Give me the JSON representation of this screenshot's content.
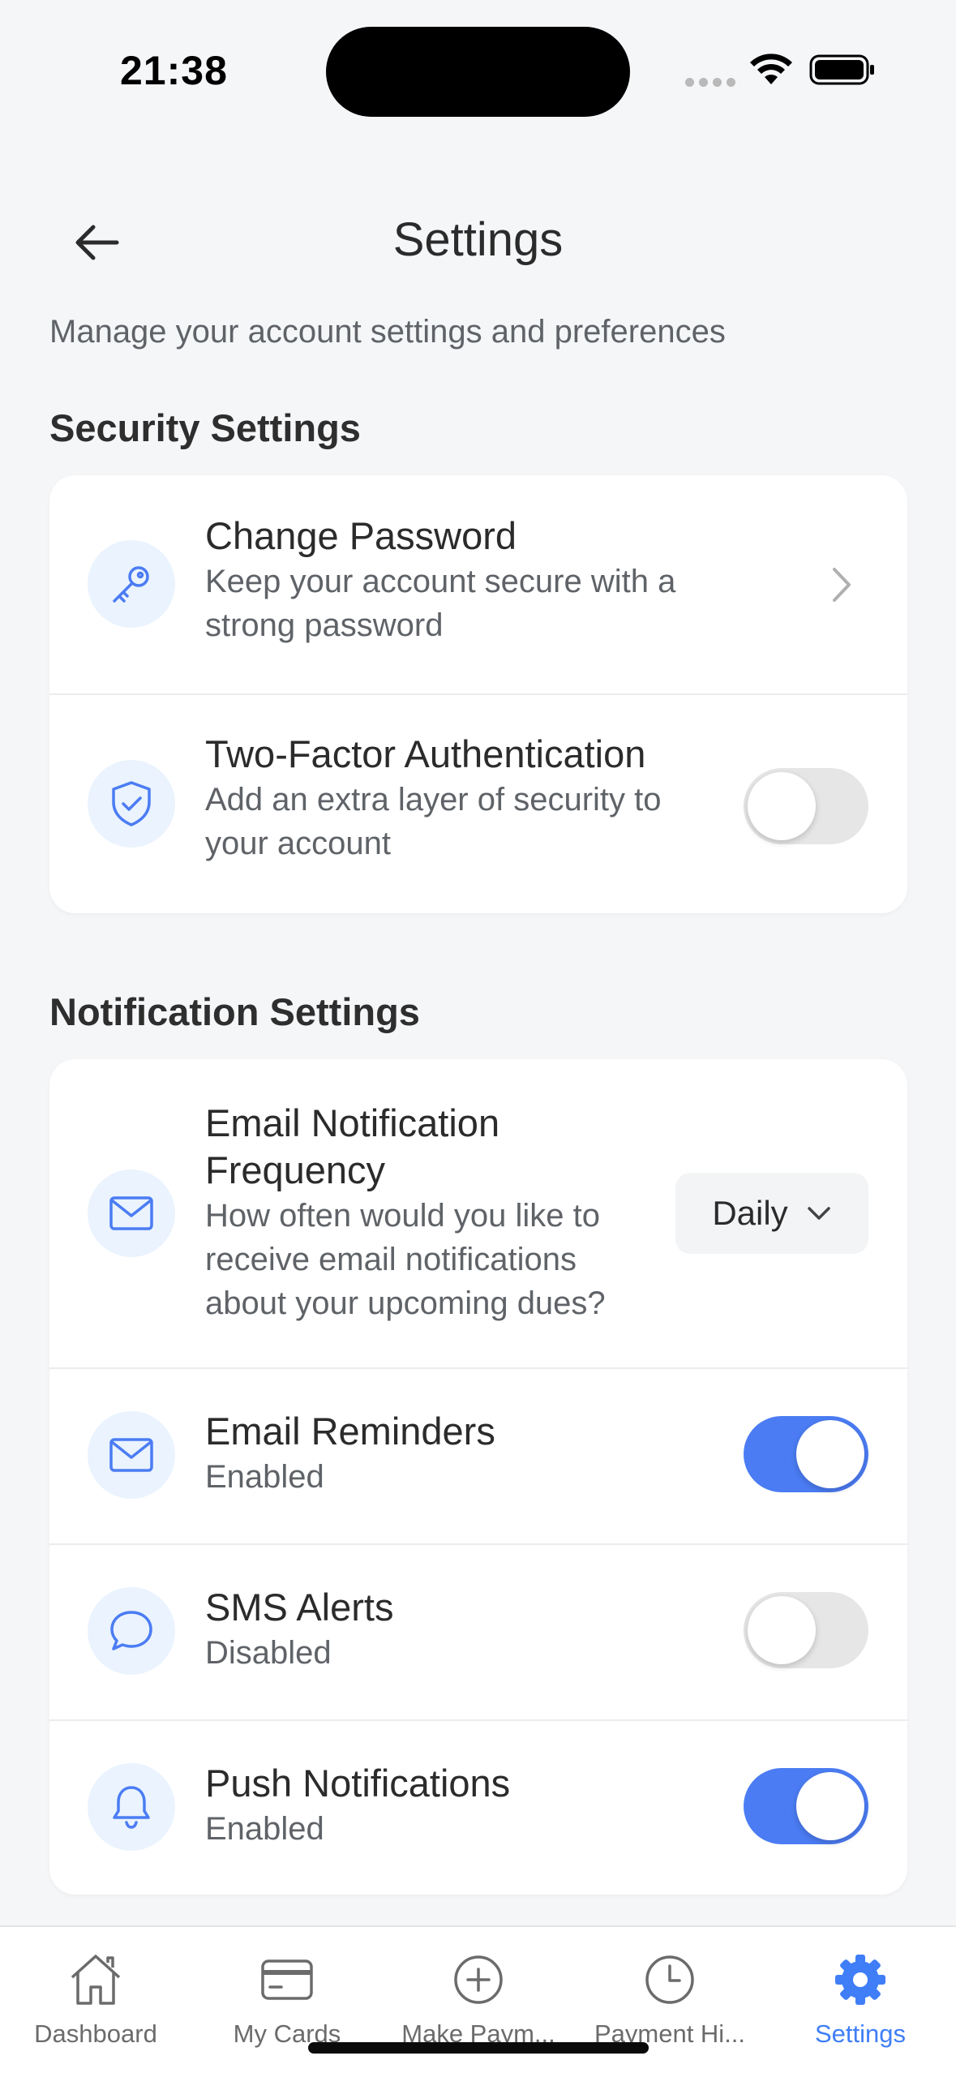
{
  "status_bar": {
    "time": "21:38"
  },
  "header": {
    "title": "Settings",
    "subtitle": "Manage your account settings and preferences"
  },
  "security": {
    "section_title": "Security Settings",
    "items": [
      {
        "title": "Change Password",
        "description": "Keep your account secure with a strong password",
        "control": "chevron",
        "icon": "key-icon"
      },
      {
        "title": "Two-Factor Authentication",
        "description": "Add an extra layer of security to your account",
        "control": "toggle",
        "enabled": false,
        "icon": "shield-check-icon"
      }
    ]
  },
  "notifications": {
    "section_title": "Notification Settings",
    "items": [
      {
        "title": "Email Notification Frequency",
        "description": "How often would you like to receive email notifications about your upcoming dues?",
        "control": "select",
        "selected": "Daily",
        "icon": "mail-icon"
      },
      {
        "title": "Email Reminders",
        "description": "Enabled",
        "control": "toggle",
        "enabled": true,
        "icon": "mail-icon"
      },
      {
        "title": "SMS Alerts",
        "description": "Disabled",
        "control": "toggle",
        "enabled": false,
        "icon": "chat-bubble-icon"
      },
      {
        "title": "Push Notifications",
        "description": "Enabled",
        "control": "toggle",
        "enabled": true,
        "icon": "bell-icon"
      }
    ]
  },
  "tab_bar": {
    "tabs": [
      {
        "label": "Dashboard",
        "icon": "home-icon",
        "active": false
      },
      {
        "label": "My Cards",
        "icon": "card-icon",
        "active": false
      },
      {
        "label": "Make Paym...",
        "icon": "plus-circle-icon",
        "active": false
      },
      {
        "label": "Payment Hi...",
        "icon": "clock-icon",
        "active": false
      },
      {
        "label": "Settings",
        "icon": "gear-icon",
        "active": true
      }
    ]
  },
  "colors": {
    "accent": "#4b7cf3",
    "icon_bg": "#eaf3fe",
    "background": "#f5f6f8",
    "active_tab": "#3f7ef6"
  }
}
